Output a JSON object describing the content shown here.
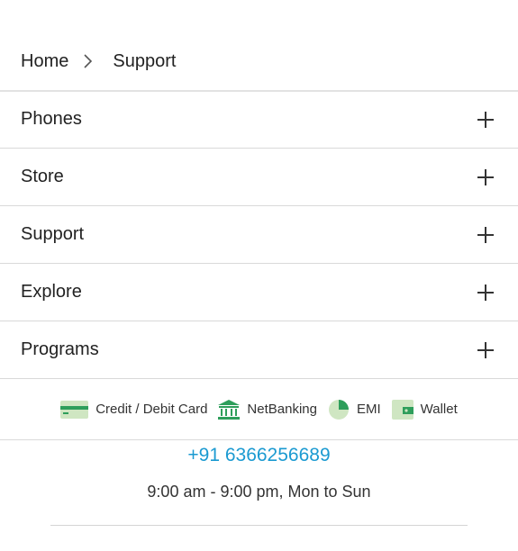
{
  "breadcrumb": {
    "home": "Home",
    "current": "Support"
  },
  "accordion": {
    "items": [
      {
        "label": "Phones"
      },
      {
        "label": "Store"
      },
      {
        "label": "Support"
      },
      {
        "label": "Explore"
      },
      {
        "label": "Programs"
      }
    ]
  },
  "payments": {
    "card": "Credit / Debit Card",
    "netbanking": "NetBanking",
    "emi": "EMI",
    "wallet": "Wallet",
    "icon_color": "#2e9e5b",
    "icon_light": "#cfe6c2"
  },
  "contact": {
    "phone": "+91 6366256689",
    "hours": "9:00 am - 9:00 pm, Mon to Sun",
    "phone_color": "#1b9ad1"
  }
}
